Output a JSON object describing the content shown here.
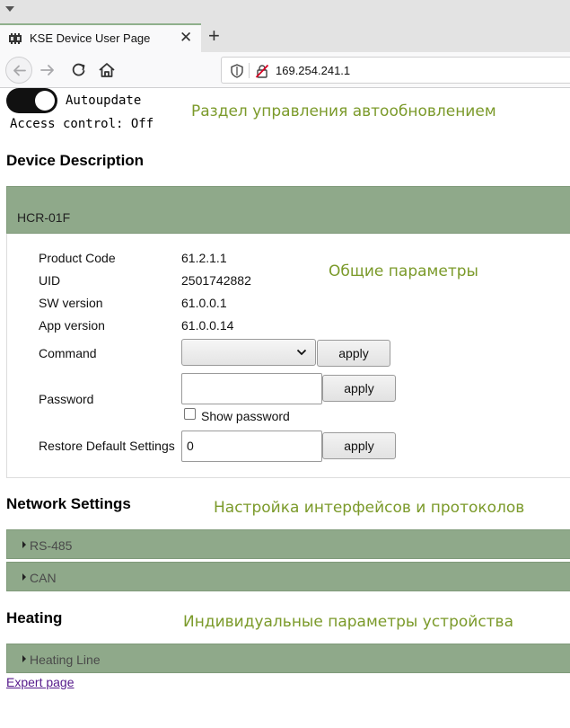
{
  "browser": {
    "tab_title": "KSE Device User Page",
    "tab_close": "✕",
    "new_tab": "+",
    "url": "169.254.241.1"
  },
  "autoupdate": {
    "toggle_on": true,
    "label": "Autoupdate",
    "access_control": "Access control: Off"
  },
  "annotations": {
    "autoupdate_section": "Раздел управления автообновлением",
    "general_params": "Общие параметры",
    "network_params": "Настройка интерфейсов и протоколов",
    "device_params": "Индивидуальные параметры устройства"
  },
  "device_description": {
    "heading": "Device Description",
    "device_name": "HCR-01F",
    "rows": [
      {
        "label": "Product Code",
        "value": "61.2.1.1"
      },
      {
        "label": "UID",
        "value": "2501742882"
      },
      {
        "label": "SW version",
        "value": "61.0.0.1"
      },
      {
        "label": "App version",
        "value": "61.0.0.14"
      }
    ],
    "command": {
      "label": "Command",
      "selected": "",
      "apply": "apply"
    },
    "password": {
      "label": "Password",
      "value": "",
      "apply": "apply",
      "show_label": "Show password",
      "show_checked": false
    },
    "restore": {
      "label": "Restore Default Settings",
      "value": "0",
      "apply": "apply"
    }
  },
  "network_settings": {
    "heading": "Network Settings",
    "items": [
      "RS-485",
      "CAN"
    ]
  },
  "heating": {
    "heading": "Heating",
    "items": [
      "Heating Line"
    ]
  },
  "footer": {
    "expert_link": "Expert page"
  },
  "colors": {
    "accent_green": "#8fa98a",
    "annotation_text": "#7b9a2a",
    "visited_link": "#551a8b"
  }
}
